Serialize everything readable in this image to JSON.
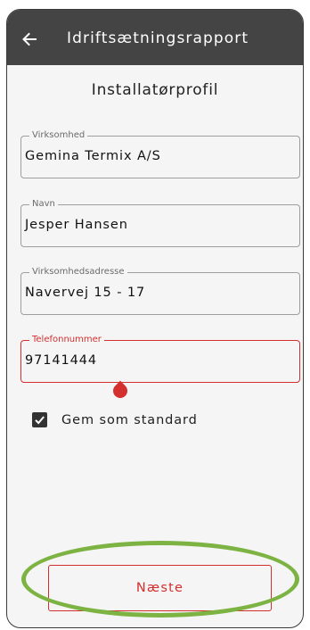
{
  "appbar": {
    "title": "Idriftsætningsrapport",
    "back_icon": "arrow-left-icon"
  },
  "page": {
    "heading": "Installatørprofil"
  },
  "form": {
    "company": {
      "label": "Virksomhed",
      "value": "Gemina Termix A/S"
    },
    "name": {
      "label": "Navn",
      "value": "Jesper Hansen"
    },
    "address": {
      "label": "Virksomhedsadresse",
      "value": "Navervej 15 - 17"
    },
    "phone": {
      "label": "Telefonnummer",
      "value": "97141444"
    }
  },
  "save_default": {
    "label": "Gem som standard",
    "checked": true
  },
  "actions": {
    "next_label": "Næste"
  },
  "colors": {
    "appbar": "#444444",
    "accent": "#d32f2f",
    "highlight": "#7cb342",
    "background": "#f5f5f5"
  }
}
